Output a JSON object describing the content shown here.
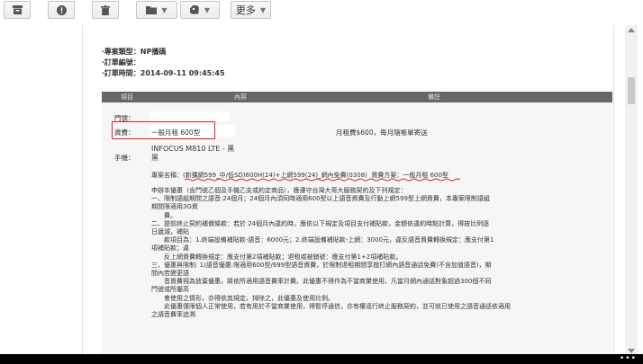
{
  "toolbar": {
    "archive_icon": "archive-icon",
    "report_icon": "report-spam-icon",
    "delete_icon": "trash-icon",
    "folder_icon": "folder-icon",
    "label_icon": "label-icon",
    "more_label": "更多"
  },
  "order": {
    "case_type": "‧專案類型：NP攜碼",
    "order_no": "‧訂單編號：",
    "order_time": "‧訂單時間：2014-09-11 09:45:45"
  },
  "table_header": {
    "item": "項目",
    "content": "內容",
    "remark": "備註"
  },
  "rows": {
    "door_label": "門號：",
    "fee_label": "資費：",
    "fee_value": "一般月租 600型",
    "fee_remark": "月租費$600，每月隨帳單寄送",
    "phone_label": "手機：",
    "phone_model": "INFOCUS M810 LTE - 黑",
    "phone_color": "黑"
  },
  "project": {
    "prefix": "專案名稱：",
    "name": "(新攜網599_中/低SD)600H(24)+上網599(24)_網內免費(0308)",
    "plan_prefix": "資費方案：",
    "plan": "一般月租 600型"
  },
  "terms": [
    "申辦本優惠（含門號乙個及手機乙支或約定商品），應遵守台灣大哥大服務契約及下列規定：",
    "一、限制語組期間之語音:24個月；24個月內須同時適用600型以上語音資費及行動上網599型上網資費，本專案限制語組",
    "期間限適用3G資",
    "　　費。",
    "二、提前終止契約補償條款：若於 24個月內違約時，應依以下規定及項目支付補貼款，金額依違約時點計算，得按比例逐",
    "日遞減，補貼",
    "　　款項目為：1.終端設備補貼款-語音：6000元；2.終端設備補貼款-上網：3000元，違反語音資費轉換規定：應支付第1",
    "項補貼款；違",
    "　　反上網資費轉換規定：應支付第2項補貼款；退租或被銷號：應支付第1+2項補貼款。",
    "三、優惠與限制: 1)語音優惠:限適用600型/699型語音資費，於限制退租期間享撥打網內語音通話免費(不含加值語音)，期",
    "間內若變更語",
    "　　音資費視為放棄優惠，將依所適用語音費率計費。此優惠不得作為不當商業使用，凡當月網內通話對象超過300個不同",
    "門號或所屬高",
    "　　會使用之情形，亦得依其規定，排除之，此優惠及使用比例。",
    "　　此優惠僅限個人正常使用，若有用於不當商業使用，得暫停通信，亦有權逕行終止服務契約，並可就已使用之語音通話依適用",
    "之語音費率追溯"
  ]
}
